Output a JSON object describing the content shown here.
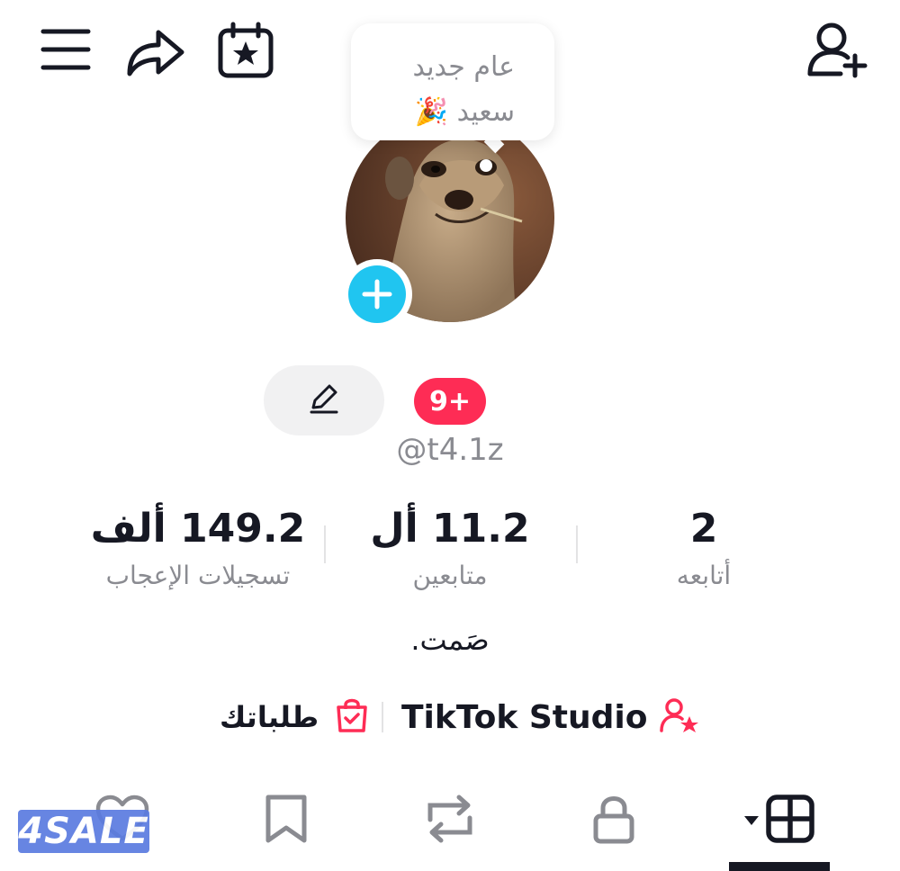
{
  "header": {
    "greeting_line1": "عام جديد",
    "greeting_line2": "سعيد 🎉"
  },
  "profile": {
    "notification_badge": "9+",
    "username": "@t4.1z",
    "bio": "صَمت."
  },
  "stats": {
    "likes": {
      "value": "149.2 ألف",
      "label": "تسجيلات الإعجاب"
    },
    "followers": {
      "value": "11.2 أل",
      "label": "متابعين"
    },
    "following": {
      "value": "2",
      "label": "أتابعه"
    }
  },
  "links": {
    "studio": "TikTok Studio",
    "orders": "طلباتك"
  },
  "tabs": [
    "liked",
    "saved",
    "reposts",
    "private",
    "videos"
  ],
  "active_tab": "videos",
  "watermark": "4SALE",
  "colors": {
    "accent_pink": "#fe2c55",
    "add_blue": "#20c5f0",
    "text_primary": "#161823",
    "text_secondary": "#8a8b91"
  },
  "icons": {
    "menu": "hamburger-menu-icon",
    "share": "share-arrow-icon",
    "calendar": "calendar-star-icon",
    "add_friend": "add-user-icon",
    "edit": "pencil-icon",
    "studio": "user-star-icon",
    "orders": "shopping-bag-icon"
  }
}
